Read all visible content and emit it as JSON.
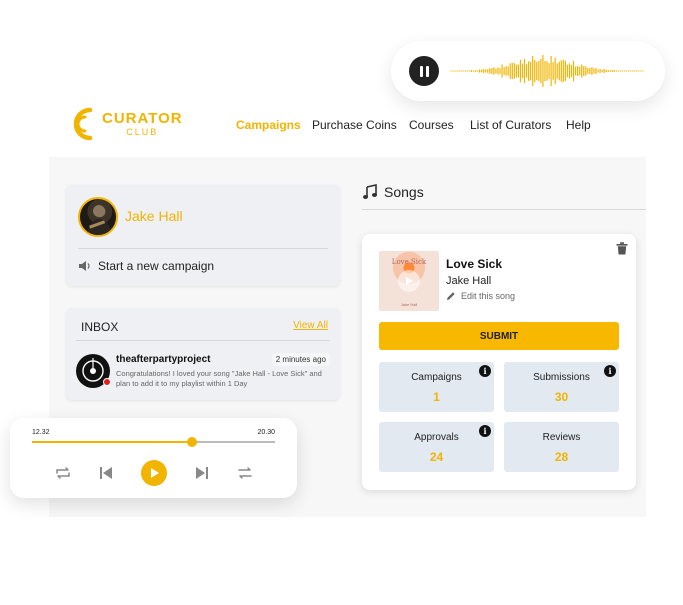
{
  "audio_snippet": {
    "state": "playing",
    "pause_icon": "pause-icon",
    "waveform_color": "#f1b400"
  },
  "logo": {
    "word1": "CURATOR",
    "word2": "CLUB",
    "brand_color": "#f1b400"
  },
  "nav": {
    "items": [
      {
        "label": "Campaigns",
        "active": true
      },
      {
        "label": "Purchase Coins",
        "active": false
      },
      {
        "label": "Courses",
        "active": false
      },
      {
        "label": "List of Curators",
        "active": false
      },
      {
        "label": "Help",
        "active": false
      }
    ]
  },
  "profile": {
    "name": "Jake Hall",
    "action_label": "Start a new campaign",
    "action_icon": "speaker-icon"
  },
  "inbox": {
    "title": "INBOX",
    "view_all": "View All",
    "messages": [
      {
        "sender": "theafterpartyproject",
        "time": "2 minutes ago",
        "text": "Congratulations! I loved your song \"Jake Hall - Love Sick\" and plan to add it to my playlist within 1 Day",
        "unread": true
      }
    ]
  },
  "player": {
    "current_time": "12.32",
    "total_time": "20.30",
    "progress": 0.66,
    "controls": [
      "repeat-one-icon",
      "skip-previous-icon",
      "play-icon",
      "skip-next-icon",
      "repeat-icon"
    ]
  },
  "songs": {
    "title": "Songs",
    "title_icon": "music-note-icon",
    "song": {
      "title": "Love Sick",
      "artist": "Jake Hall",
      "cover_title": "Love Sick",
      "cover_artist": "Jake Hall",
      "edit_label": "Edit this song",
      "submit_label": "SUBMIT",
      "stats": [
        {
          "label": "Campaigns",
          "value": "1",
          "info": true
        },
        {
          "label": "Submissions",
          "value": "30",
          "info": true
        },
        {
          "label": "Approvals",
          "value": "24",
          "info": true
        },
        {
          "label": "Reviews",
          "value": "28",
          "info": false
        }
      ]
    }
  },
  "colors": {
    "accent": "#f1b400",
    "submit": "#f8b800",
    "stat_bg": "#e3e9f1",
    "card_bg": "#eef0f3"
  }
}
